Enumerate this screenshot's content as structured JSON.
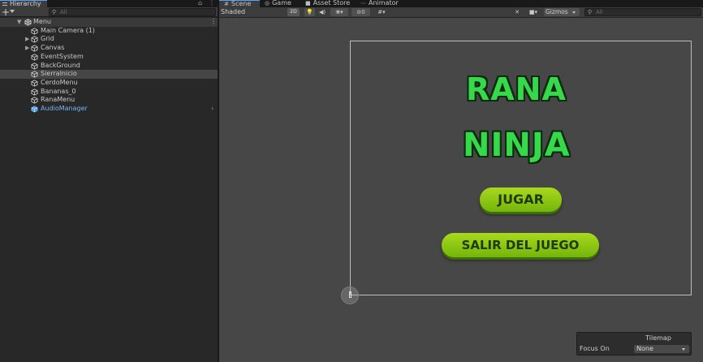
{
  "hierarchy": {
    "tab_label": "Hierarchy",
    "lock_icon": "lock-icon",
    "menu_icon": "kebab-icon",
    "add_label": "+",
    "search_placeholder": "All",
    "items": [
      {
        "label": "Menu",
        "kind": "scene",
        "kebab": "⋮"
      },
      {
        "label": "Main Camera (1)",
        "kind": "gameobject"
      },
      {
        "label": "Grid",
        "kind": "gameobject",
        "expandable": true
      },
      {
        "label": "Canvas",
        "kind": "gameobject",
        "expandable": true
      },
      {
        "label": "EventSystem",
        "kind": "gameobject"
      },
      {
        "label": "BackGround",
        "kind": "gameobject"
      },
      {
        "label": "SierraInicio",
        "kind": "gameobject",
        "highlighted": true
      },
      {
        "label": "CerdoMenu",
        "kind": "gameobject"
      },
      {
        "label": "Bananas_0",
        "kind": "gameobject"
      },
      {
        "label": "RanaMenu",
        "kind": "gameobject"
      },
      {
        "label": "AudioManager",
        "kind": "prefab",
        "chevron": "›"
      }
    ]
  },
  "scene_tabs": {
    "scene": "Scene",
    "game": "Game",
    "asset_store": "Asset Store",
    "animator": "Animator"
  },
  "scene_toolbar": {
    "shading_mode": "Shaded",
    "mode_2d": "2D",
    "hidden_count": "0",
    "gizmos": "Gizmos",
    "search_placeholder": "All"
  },
  "game_view": {
    "title_line1": "RANA",
    "title_line2": "NINJA",
    "play_button": "JUGAR",
    "quit_button": "SALIR DEL JUEGO"
  },
  "tilemap_overlay": {
    "title": "Tilemap",
    "focus_label": "Focus On",
    "focus_value": "None"
  },
  "colors": {
    "title_green": "#35d94a",
    "button_green": "#8fc714",
    "selection_blue": "#58a0ff",
    "prefab_blue": "#79b4f2"
  }
}
